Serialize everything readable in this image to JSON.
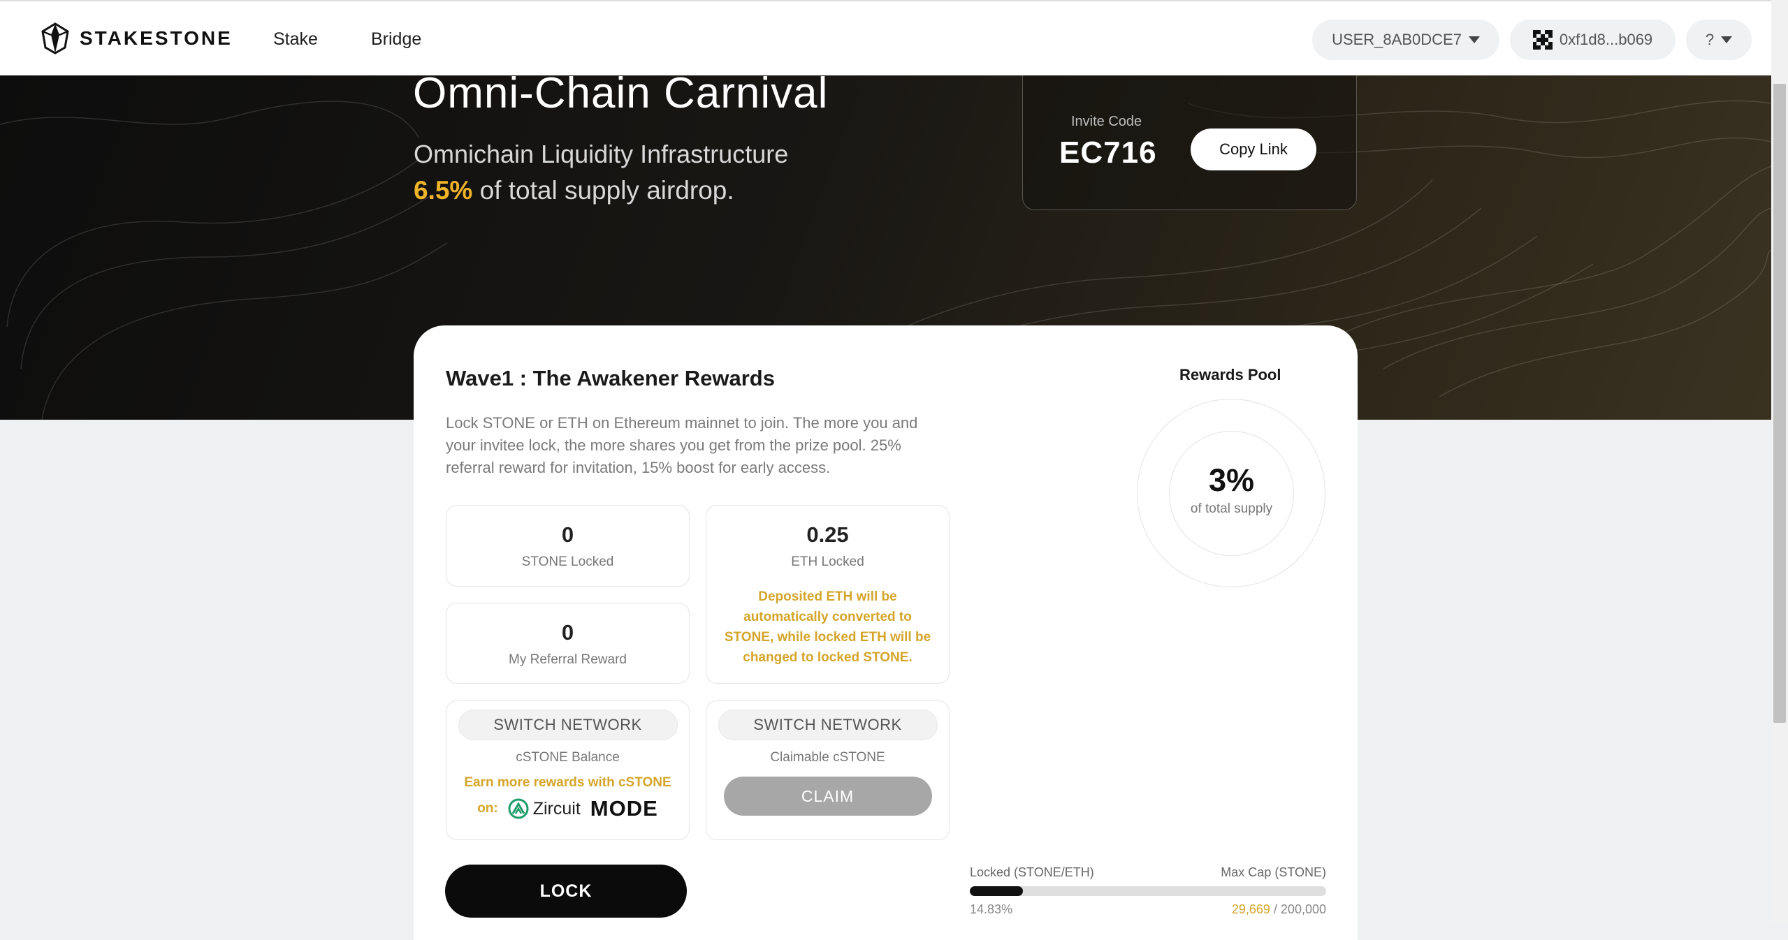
{
  "header": {
    "logo_text": "STAKESTONE",
    "nav": {
      "stake": "Stake",
      "bridge": "Bridge"
    },
    "user_id": "USER_8AB0DCE7",
    "wallet": "0xf1d8...b069",
    "help": "?"
  },
  "hero": {
    "title": "Omni-Chain Carnival",
    "subtitle": "Omnichain Liquidity Infrastructure",
    "airdrop_pct": "6.5%",
    "airdrop_text": "of total supply airdrop."
  },
  "invite": {
    "label": "Invite Code",
    "code": "EC716",
    "copy_label": "Copy Link"
  },
  "wave": {
    "title": "Wave1 :  The Awakener Rewards",
    "description": "Lock STONE or ETH on Ethereum mainnet to join. The more you and your invitee lock, the more shares you get from the prize pool. 25% referral reward for invitation, 15% boost for early access."
  },
  "stats": {
    "stone_locked_value": "0",
    "stone_locked_label": "STONE Locked",
    "eth_locked_value": "0.25",
    "eth_locked_label": "ETH Locked",
    "eth_note": "Deposited ETH will be automatically converted to STONE, while locked ETH will be changed to locked STONE.",
    "referral_value": "0",
    "referral_label": "My Referral Reward"
  },
  "cstone": {
    "switch_label": "SWITCH NETWORK",
    "balance_label": "cSTONE Balance",
    "earn_text": "Earn more rewards with cSTONE",
    "earn_on": "on:",
    "partner1": "Zircuit",
    "partner2": "MODE"
  },
  "claim": {
    "switch_label": "SWITCH NETWORK",
    "claimable_label": "Claimable cSTONE",
    "claim_label": "CLAIM"
  },
  "lock_label": "LOCK",
  "pool": {
    "title": "Rewards Pool",
    "pct": "3%",
    "sub": "of total supply"
  },
  "progress": {
    "left_label": "Locked (STONE/ETH)",
    "right_label": "Max Cap (STONE)",
    "percent_text": "14.83%",
    "fraction": 0.1483,
    "locked_amount": "29,669",
    "cap_text": " / 200,000"
  },
  "colors": {
    "accent_gold": "#d4a52a",
    "hero_gold": "#f0b429"
  }
}
